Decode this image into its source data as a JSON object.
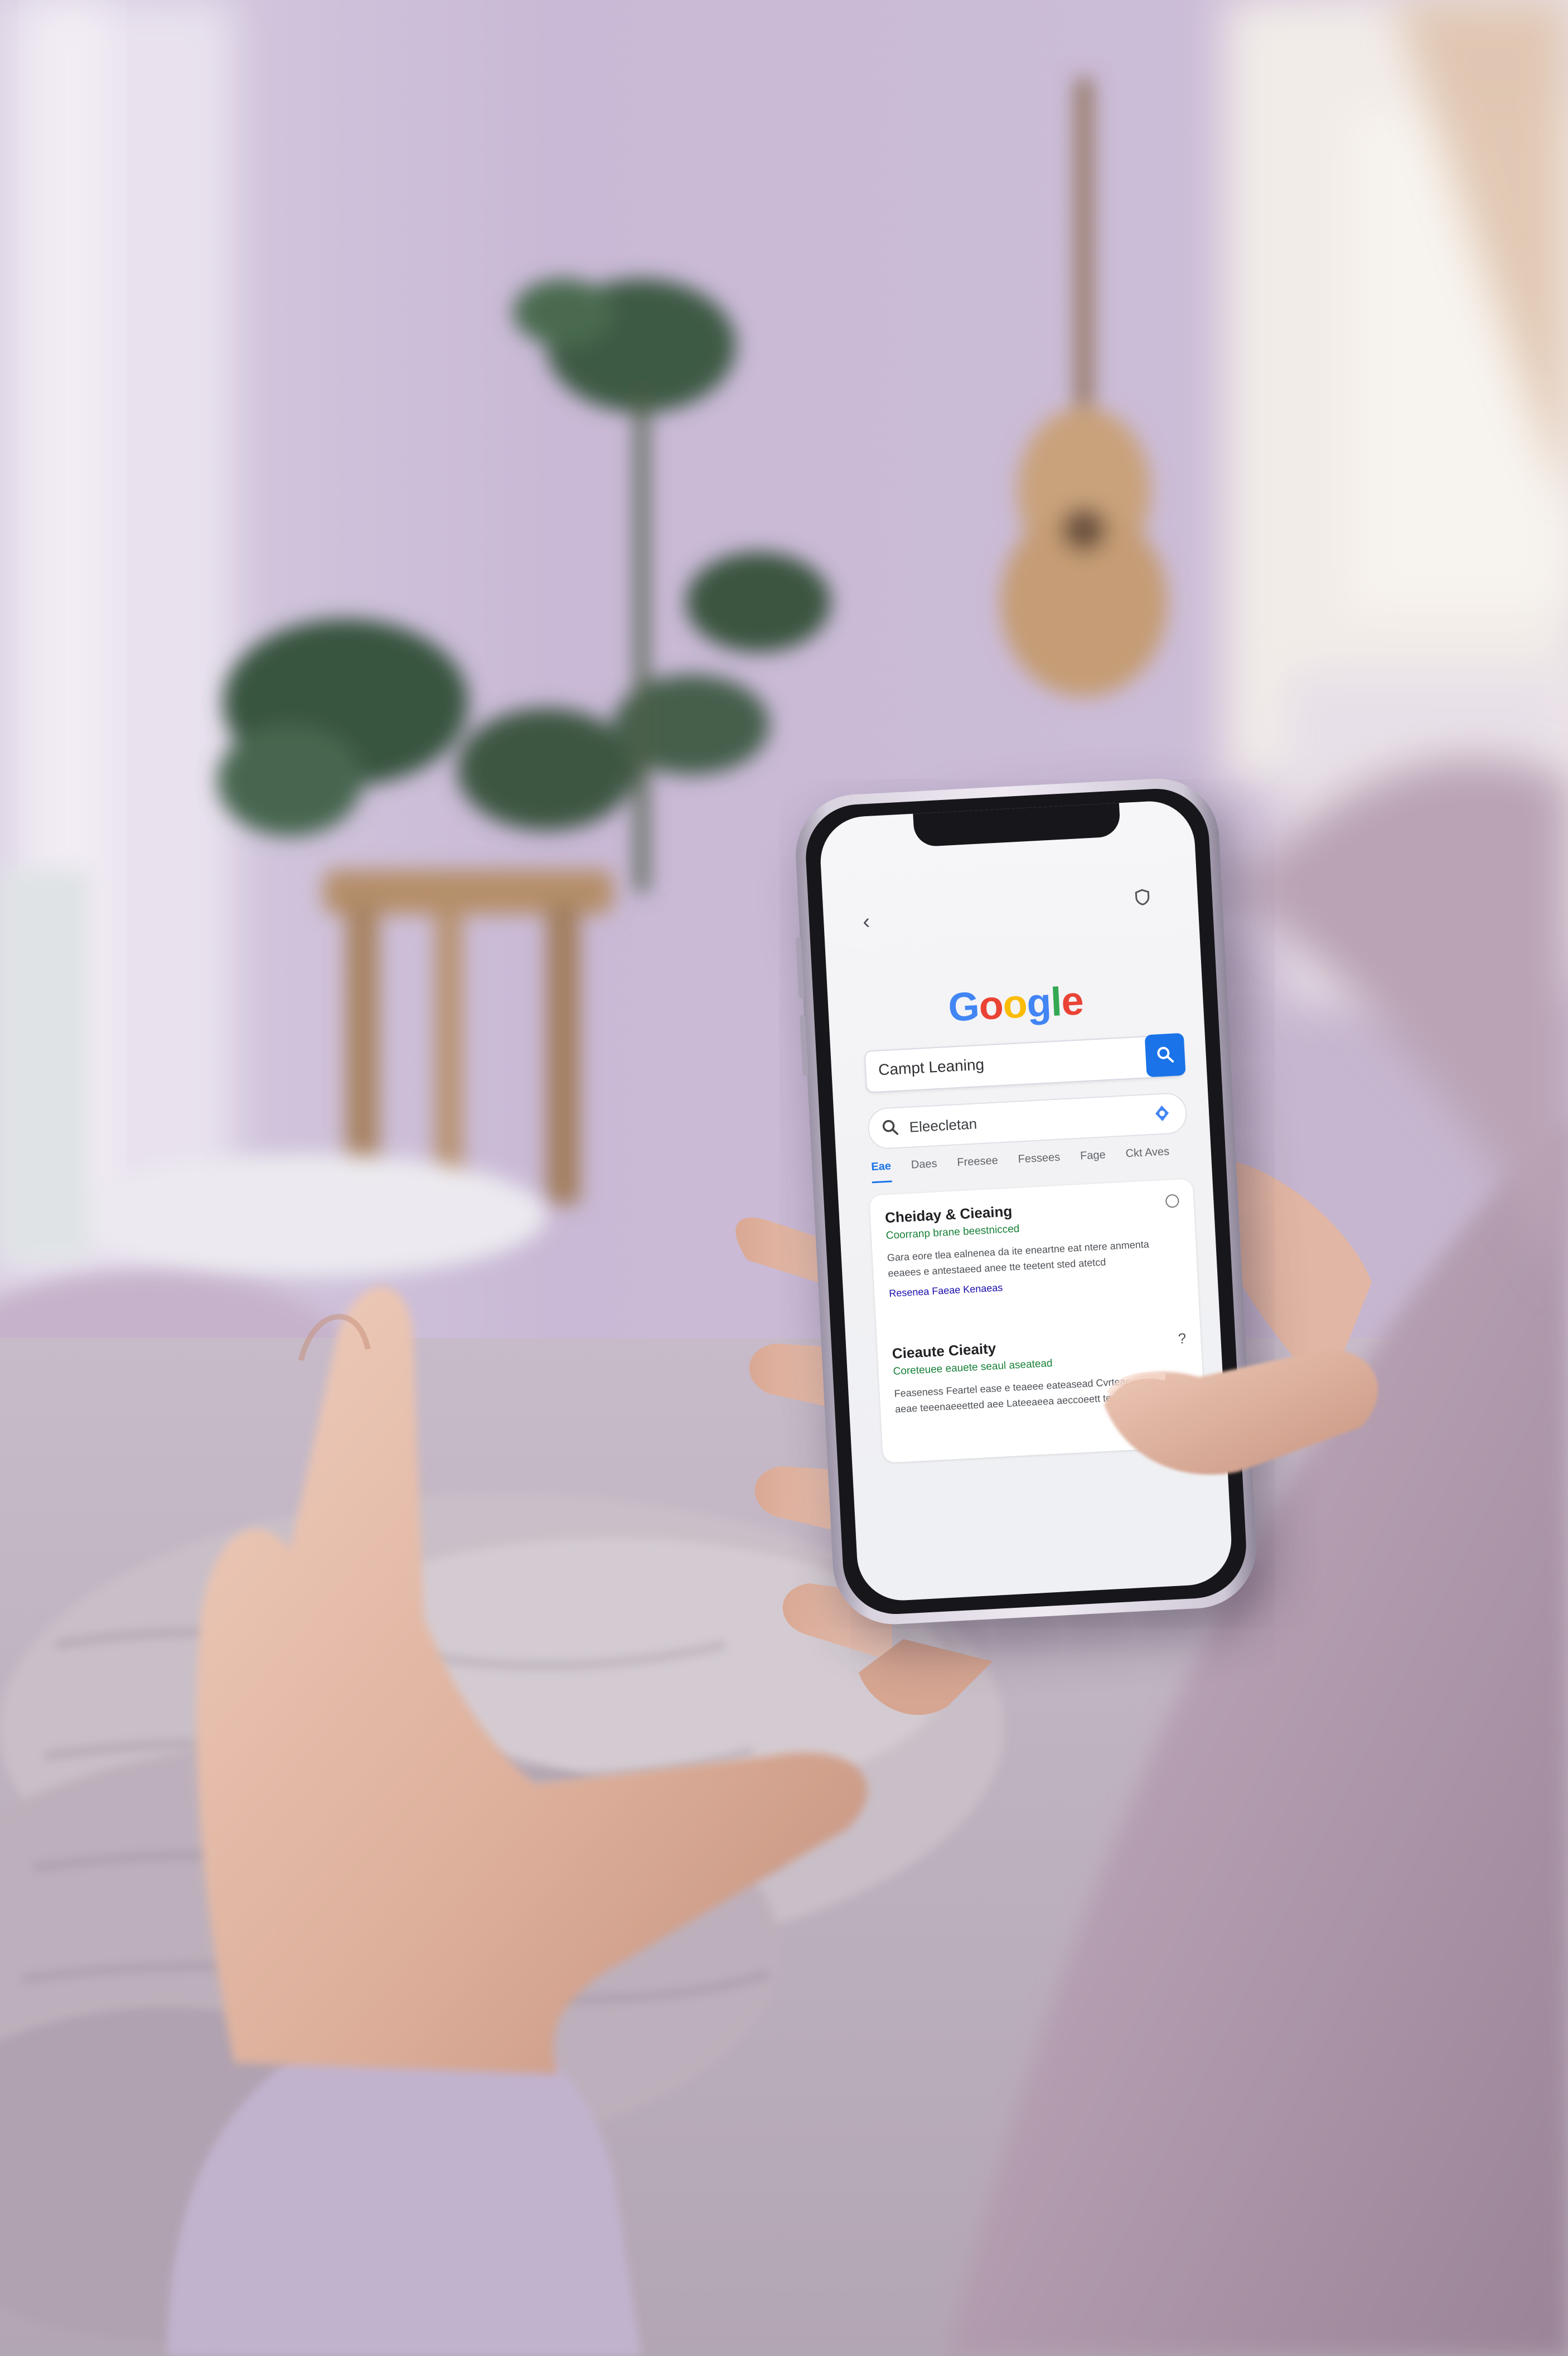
{
  "scene": {
    "palette": {
      "wall": "#cbbcd6",
      "floor_blanket": "#c2b8c6",
      "sweater": "#b6a3b8",
      "skin": "#e4b9a6",
      "plant": "#3e5d47",
      "wood": "#b08d69"
    }
  },
  "phone": {
    "browser": {
      "back_icon": "back-arrow-icon",
      "shield_icon": "shield-icon"
    },
    "google_logo": {
      "letters": [
        "G",
        "o",
        "o",
        "g",
        "l",
        "e"
      ],
      "colors": [
        "#4285F4",
        "#EA4335",
        "#FBBC05",
        "#4285F4",
        "#34A853",
        "#EA4335"
      ]
    },
    "search": {
      "query": "Campt Leaning",
      "button_icon": "search-icon"
    },
    "secondary_search": {
      "text": "Eleecletan",
      "icon": "lens-icon"
    },
    "tabs": [
      "Eae",
      "Daes",
      "Freesee",
      "Fessees",
      "Fage",
      "Ckt Aves"
    ],
    "active_tab": 0,
    "results": [
      {
        "title": "Cheiday & Cieaing",
        "subtitle": "Coorranp  brane beestnicced",
        "snippet": "Gara eore tlea ealnenea da ite eneartne eat ntere anmenta eeaees e antestaeed anee tte teetent sted atetcd",
        "links": "Resenea  Faeae  Kenaeas",
        "icon": "info-icon"
      },
      {
        "title": "Cieaute Cieaity",
        "subtitle": "Coreteuee eauete seaul aseatead",
        "snippet": "Feaseness  Feartel ease e teaeee eateasead Cvrteaeeaet neut aeae  teeenaeeetted aee Lateeaeea  aeccoeett teat",
        "links": "",
        "icon": "help-icon"
      }
    ]
  }
}
